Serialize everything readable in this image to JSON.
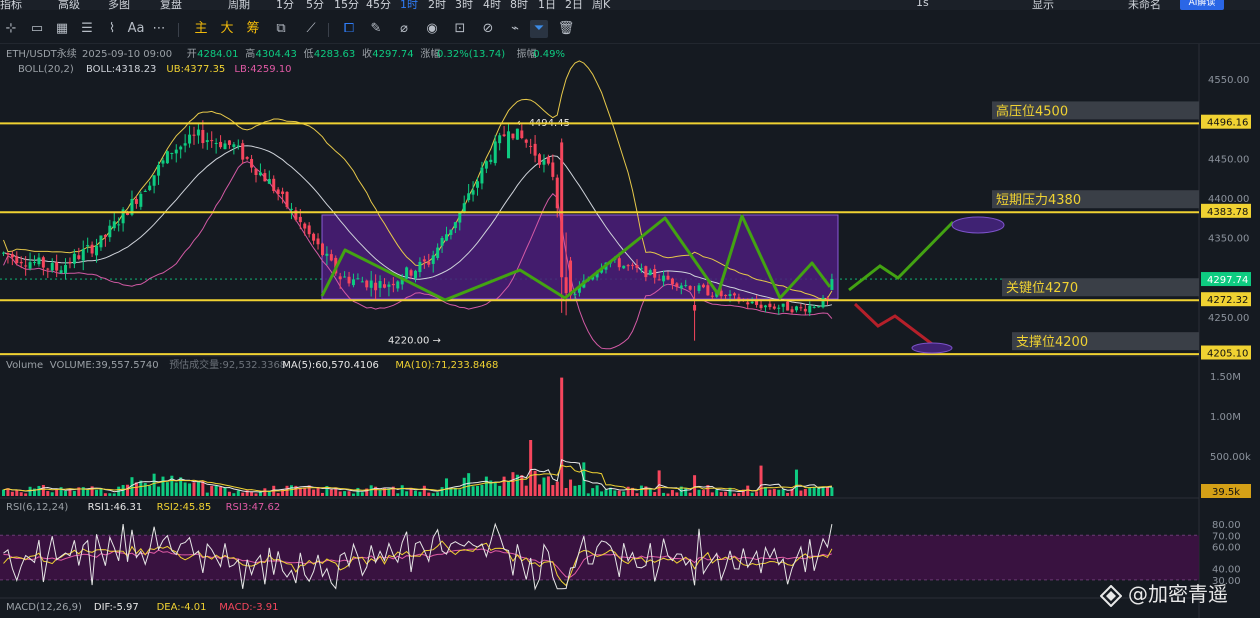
{
  "top_menu": {
    "indicators": "指标",
    "advanced": "高级",
    "multi": "多图",
    "replay": "复盘",
    "period": "周期",
    "intervals": [
      "1分",
      "5分",
      "15分",
      "45分",
      "1时",
      "2时",
      "3时",
      "4时",
      "8时",
      "1日",
      "2日",
      "周K"
    ],
    "active_interval": "1时",
    "right_time": "1s",
    "display": "显示",
    "unnamed": "未命名",
    "ai_label": "AI解读"
  },
  "toolbar": {
    "main_label": "主",
    "big_label": "大",
    "chip_label": "筹"
  },
  "colors": {
    "background": "#151a21",
    "up": "#0ecb81",
    "down": "#f6465d",
    "level_line": "#f0d232",
    "range_box": "#4b1d7a",
    "range_border": "#8a5bd8",
    "boll_mid": "#cfd3da",
    "boll_upper": "#e6c84a",
    "boll_lower": "#d35aa5",
    "path_green": "#43a312",
    "path_red": "#b5202a",
    "rsi_band": "#3d1244",
    "dark_label": "#3a3f47"
  },
  "price_panel": {
    "symbol": "ETH/USDT永续",
    "info_parts": [
      {
        "text": "2025-09-10 09:00",
        "color": "#9aa0a6"
      },
      {
        "text": "开",
        "color": "#9aa0a6"
      },
      {
        "text": "4284.01",
        "color": "#0ecb81"
      },
      {
        "text": "高",
        "color": "#9aa0a6"
      },
      {
        "text": "4304.43",
        "color": "#0ecb81"
      },
      {
        "text": "低",
        "color": "#9aa0a6"
      },
      {
        "text": "4283.63",
        "color": "#0ecb81"
      },
      {
        "text": "收",
        "color": "#9aa0a6"
      },
      {
        "text": "4297.74",
        "color": "#0ecb81"
      },
      {
        "text": "涨幅",
        "color": "#9aa0a6"
      },
      {
        "text": "0.32%(13.74)",
        "color": "#0ecb81"
      },
      {
        "text": "振幅",
        "color": "#9aa0a6"
      },
      {
        "text": "0.49%",
        "color": "#0ecb81"
      }
    ],
    "boll_legend": [
      {
        "text": "BOLL(20,2)",
        "color": "#9aa0a6"
      },
      {
        "text": "BOLL:4318.23",
        "color": "#cfd3da"
      },
      {
        "text": "UB:4377.35",
        "color": "#f0d232"
      },
      {
        "text": "LB:4259.10",
        "color": "#e05aa5"
      }
    ],
    "y_ticks": [
      4550,
      4500,
      4450,
      4400,
      4350,
      4300,
      4250
    ],
    "y_tick_labels": [
      "4550.00",
      "4500.00",
      "4450.00",
      "4400.00",
      "4350.00",
      "4300.00",
      "4250.00"
    ],
    "high_marker": "4494.45",
    "low_marker": "4220.00",
    "current_price": "4297.74",
    "price_tags": [
      {
        "price": 4496.16,
        "label": "4496.16"
      },
      {
        "price": 4383.78,
        "label": "4383.78"
      },
      {
        "price": 4272.32,
        "label": "4272.32"
      },
      {
        "price": 4205.1,
        "label": "4205.10"
      }
    ],
    "levels": [
      {
        "price": 4494,
        "text": "高压位4500"
      },
      {
        "price": 4382,
        "text": "短期压力4380"
      },
      {
        "price": 4271,
        "text": "关键位4270"
      },
      {
        "price": 4203,
        "text": "支撑位4200"
      }
    ]
  },
  "volume_panel": {
    "legend": [
      {
        "text": "Volume",
        "color": "#9aa0a6"
      },
      {
        "text": "VOLUME:39,557.5740",
        "color": "#9aa0a6"
      },
      {
        "text": "预估成交量:92,532.3368",
        "color": "#6c727a"
      },
      {
        "text": "MA(5):60,570.4106",
        "color": "#e6e6e6"
      },
      {
        "text": "MA(10):71,233.8468",
        "color": "#f0d232"
      }
    ],
    "y_tick_labels": [
      "1.50M",
      "1.00M",
      "500.00k"
    ],
    "current_label": "39.5k"
  },
  "rsi_panel": {
    "legend": [
      {
        "text": "RSI(6,12,24)",
        "color": "#9aa0a6"
      },
      {
        "text": "RSI1:46.31",
        "color": "#e6e6e6"
      },
      {
        "text": "RSI2:45.85",
        "color": "#f0d232"
      },
      {
        "text": "RSI3:47.62",
        "color": "#e05aa5"
      }
    ],
    "y_tick_labels": [
      "80.00",
      "70.00",
      "60.00",
      "40.00",
      "30.00"
    ]
  },
  "macd_panel": {
    "legend": [
      {
        "text": "MACD(12,26,9)",
        "color": "#9aa0a6"
      },
      {
        "text": "DIF:-5.97",
        "color": "#e6e6e6"
      },
      {
        "text": "DEA:-4.01",
        "color": "#f0d232"
      },
      {
        "text": "MACD:-3.91",
        "color": "#f6465d"
      }
    ]
  },
  "watermark": "@加密青遥"
}
